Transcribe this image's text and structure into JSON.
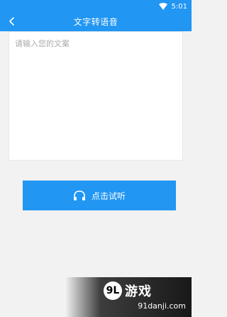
{
  "status_bar": {
    "time": "5:01",
    "wifi_icon": "wifi-icon"
  },
  "header": {
    "title": "文字转语音",
    "back_icon": "chevron-left-icon"
  },
  "editor": {
    "placeholder": "请输入您的文案",
    "value": ""
  },
  "action": {
    "label": "点击试听",
    "icon": "headphones-icon"
  },
  "watermark": {
    "badge": "9L",
    "brand": "游戏",
    "url": "91danji.com"
  },
  "colors": {
    "accent": "#2196f3",
    "background": "#f2f2f2",
    "card": "#ffffff",
    "placeholder": "#aaaaaa"
  }
}
